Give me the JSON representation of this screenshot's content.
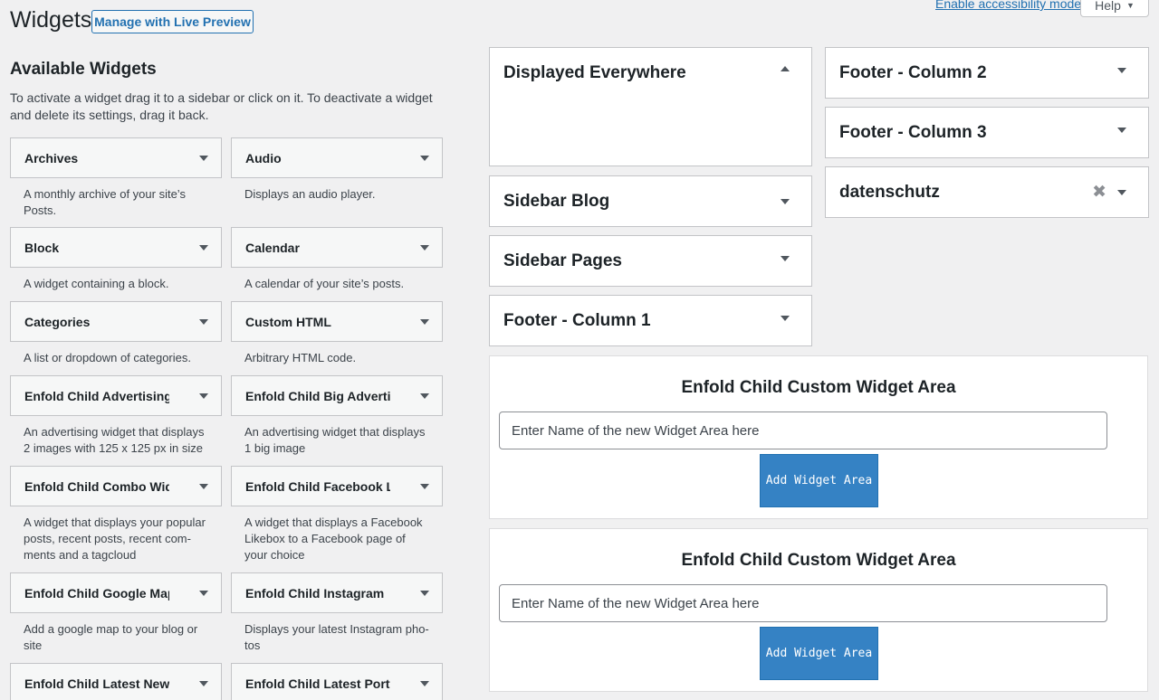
{
  "header": {
    "title": "Widgets",
    "live_preview_label": "Manage with Live Preview",
    "accessibility_link": "Enable accessibility mode",
    "help_label": "Help"
  },
  "available": {
    "title": "Available Widgets",
    "description": "To activate a widget drag it to a sidebar or click on it. To deactivate a widget and delete its settings, drag it back.",
    "widgets": [
      {
        "name": "Archives",
        "desc": "A monthly archive of your site’s Posts."
      },
      {
        "name": "Audio",
        "desc": "Displays an audio player."
      },
      {
        "name": "Block",
        "desc": "A widget containing a block."
      },
      {
        "name": "Calendar",
        "desc": "A calendar of your site’s posts."
      },
      {
        "name": "Categories",
        "desc": "A list or dropdown of categories."
      },
      {
        "name": "Custom HTML",
        "desc": "Arbitrary HTML code."
      },
      {
        "name": "Enfold Child Advertising Area",
        "desc": "An advertising widget that displays 2 images with 125 x 125 px in size"
      },
      {
        "name": "Enfold Child Big Advertising Area",
        "desc": "An advertising widget that displays 1 big image"
      },
      {
        "name": "Enfold Child Combo Widget",
        "desc": "A widget that displays your popular posts, recent posts, recent com- ments and a tagcloud"
      },
      {
        "name": "Enfold Child Facebook Likebox",
        "desc": "A widget that displays a Facebook Likebox to a Facebook page of your choice"
      },
      {
        "name": "Enfold Child Google Maps Widget",
        "desc": "Add a google map to your blog or site"
      },
      {
        "name": "Enfold Child Instagram",
        "desc": "Displays your latest Instagram pho- tos"
      },
      {
        "name": "Enfold Child Latest News",
        "desc": ""
      },
      {
        "name": "Enfold Child Latest Portfolio",
        "desc": ""
      }
    ]
  },
  "sidebars": {
    "displayed_everywhere": "Displayed Everywhere",
    "sidebar_blog": "Sidebar Blog",
    "sidebar_pages": "Sidebar Pages",
    "footer_col1": "Footer - Column 1",
    "footer_col2": "Footer - Column 2",
    "footer_col3": "Footer - Column 3",
    "datenschutz": "datenschutz"
  },
  "custom_areas": [
    {
      "title": "Enfold Child Custom Widget Area",
      "placeholder": "Enter Name of the new Widget Area here",
      "button": "Add Widget Area"
    },
    {
      "title": "Enfold Child Custom Widget Area",
      "placeholder": "Enter Name of the new Widget Area here",
      "button": "Add Widget Area"
    }
  ]
}
